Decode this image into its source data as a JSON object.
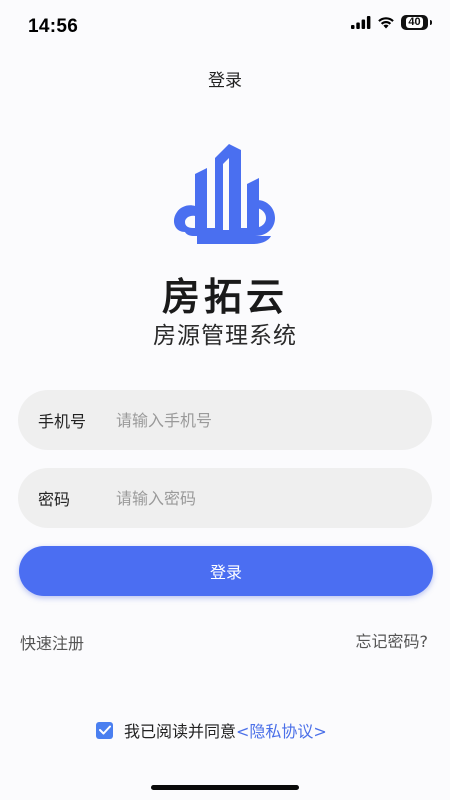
{
  "status_bar": {
    "time": "14:56",
    "battery_level": "40",
    "signal_icon": "signal-bars-icon",
    "wifi_icon": "wifi-icon",
    "battery_icon": "battery-icon"
  },
  "nav": {
    "title": "登录"
  },
  "brand": {
    "logo_icon": "building-cloud-logo-icon",
    "name": "房拓云",
    "subtitle": "房源管理系统",
    "accent_color": "#4b6ef2"
  },
  "form": {
    "phone": {
      "label": "手机号",
      "placeholder": "请输入手机号",
      "value": ""
    },
    "password": {
      "label": "密码",
      "placeholder": "请输入密码",
      "value": ""
    },
    "login_button": "登录"
  },
  "links": {
    "quick_register": "快速注册",
    "forgot_password": "忘记密码?"
  },
  "agreement": {
    "checked": true,
    "text": "我已阅读并同意",
    "link": "<隐私协议>"
  }
}
